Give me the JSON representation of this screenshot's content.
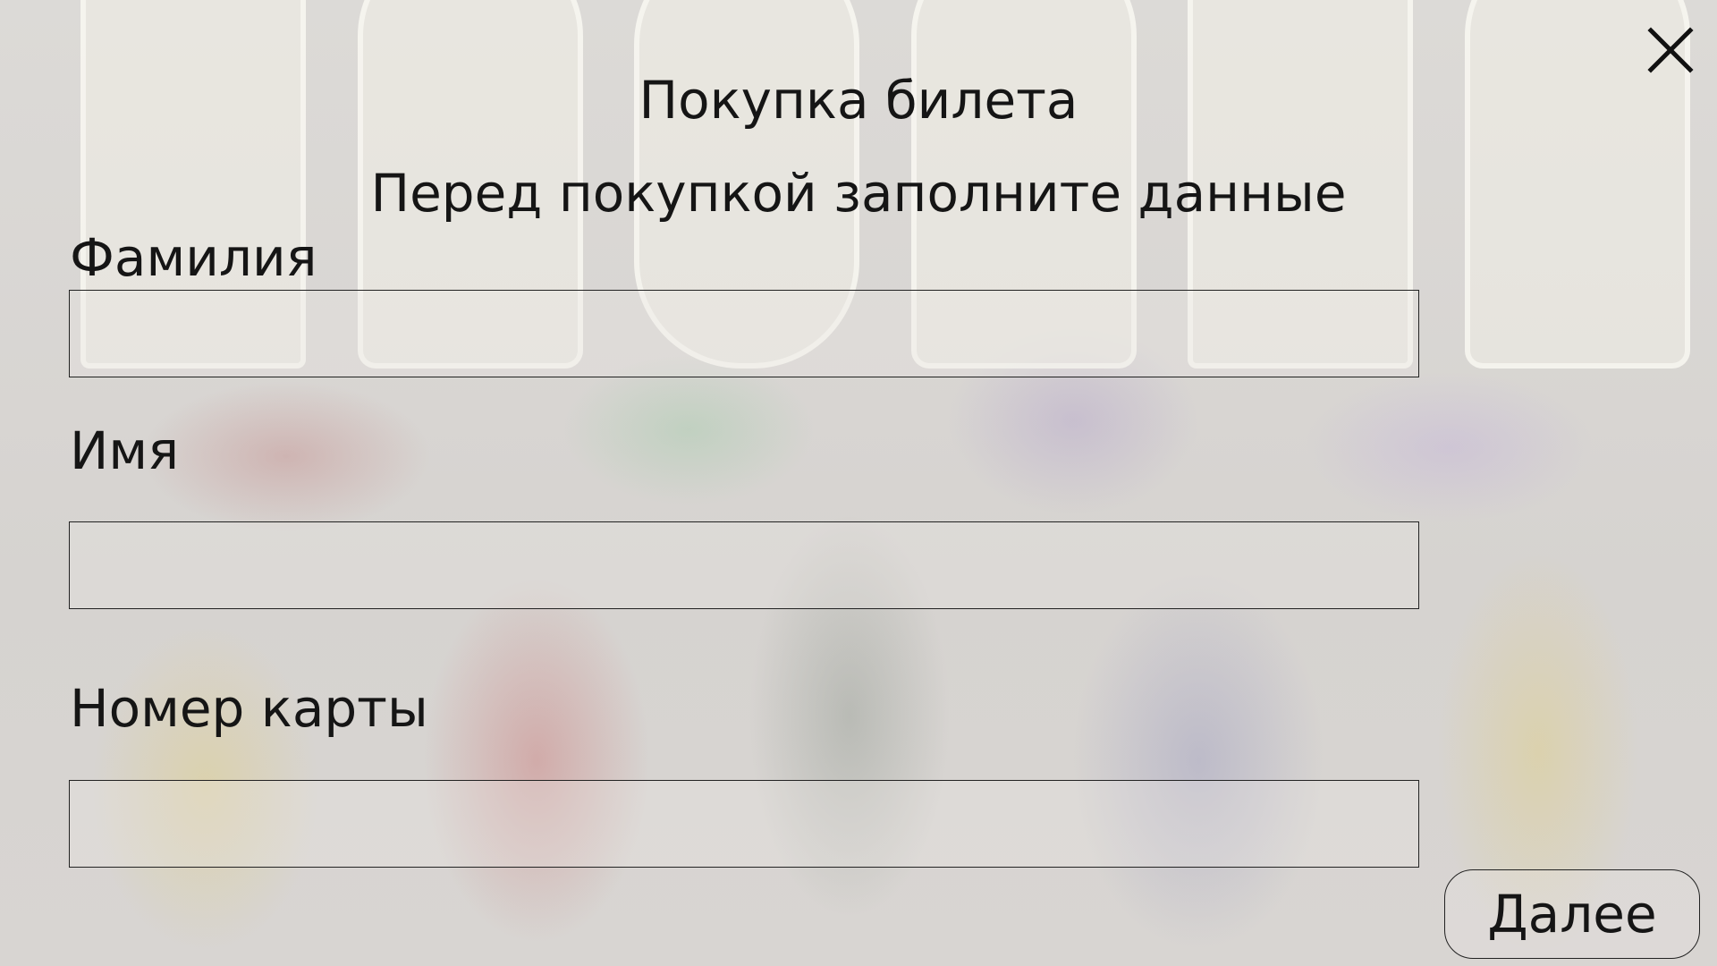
{
  "dialog": {
    "title": "Покупка билета",
    "subtitle": "Перед покупкой заполните данные"
  },
  "close_icon": "close-icon",
  "fields": {
    "surname": {
      "label": "Фамилия",
      "value": "",
      "placeholder": ""
    },
    "name": {
      "label": "Имя",
      "value": "",
      "placeholder": ""
    },
    "card": {
      "label": "Номер карты",
      "value": "",
      "placeholder": ""
    }
  },
  "next_button": {
    "label": "Далее"
  }
}
